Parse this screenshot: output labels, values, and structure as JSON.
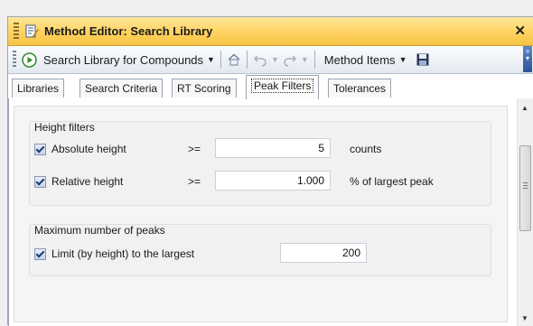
{
  "window": {
    "title": "Method Editor: Search Library"
  },
  "toolbar": {
    "action_label": "Search Library for Compounds",
    "items_label": "Method Items"
  },
  "tabs": [
    {
      "label": "Libraries"
    },
    {
      "label": "Search Criteria"
    },
    {
      "label": "RT Scoring"
    },
    {
      "label": "Peak Filters",
      "active": true
    },
    {
      "label": "Tolerances"
    }
  ],
  "height_filters": {
    "title": "Height filters",
    "absolute": {
      "label": "Absolute height",
      "operator": ">=",
      "value": "5",
      "unit": "counts",
      "checked": true
    },
    "relative": {
      "label": "Relative height",
      "operator": ">=",
      "value": "1.000",
      "unit": "% of largest peak",
      "checked": true
    }
  },
  "max_peaks": {
    "title": "Maximum number of peaks",
    "limit": {
      "label": "Limit (by height) to the largest",
      "value": "200",
      "checked": true
    }
  },
  "icons": [
    "grip-icon",
    "method-editor-icon",
    "close-icon",
    "run-icon",
    "home-icon",
    "undo-icon",
    "redo-icon",
    "save-icon",
    "overflow-icon",
    "scroll-up-icon",
    "scroll-down-icon"
  ],
  "colors": {
    "title_bar": "#ffd260",
    "run_green": "#2f8a2a",
    "tab_border": "#9aa3b3"
  }
}
